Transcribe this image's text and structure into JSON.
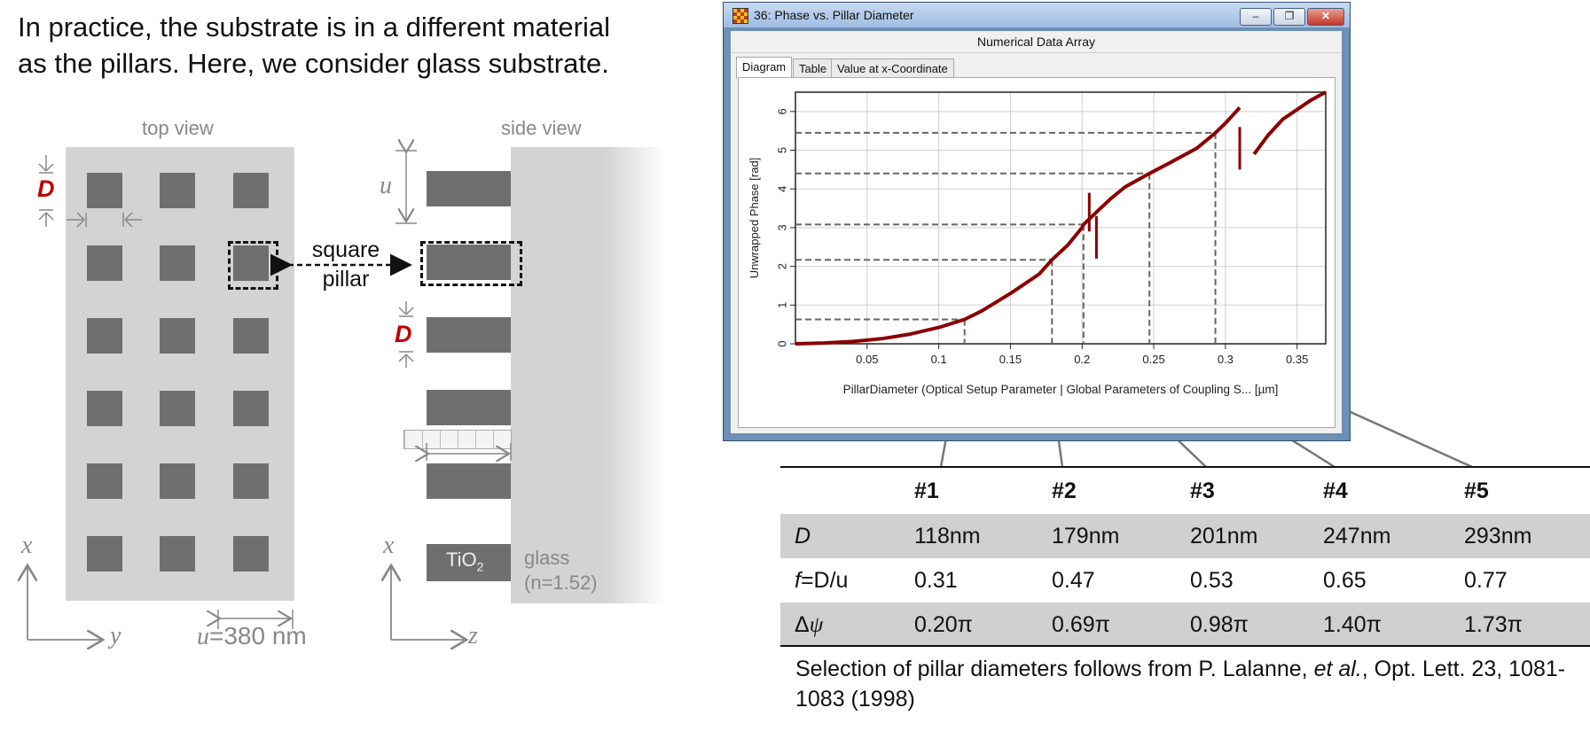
{
  "intro": {
    "line1": "In practice, the substrate is in a different material",
    "line2": "as the pillars. Here, we consider glass substrate."
  },
  "diagram": {
    "top_view_label": "top view",
    "side_view_label": "side view",
    "d_symbol": "D",
    "u_symbol": "u",
    "pillar_label_line1": "square",
    "pillar_label_line2": "pillar",
    "x_axis_symbol": "x",
    "y_axis_symbol": "y",
    "z_axis_symbol": "z",
    "period_label_var": "u",
    "period_label_value": "=380 nm",
    "tio2_label": "TiO",
    "tio2_sub": "2",
    "glass_label": "glass",
    "glass_index": "(n=1.52)"
  },
  "window": {
    "title": "36: Phase vs. Pillar Diameter",
    "header": "Numerical Data Array",
    "tabs": [
      "Diagram",
      "Table",
      "Value at x-Coordinate"
    ],
    "active_tab": "Diagram",
    "buttons": {
      "minimize": "‒",
      "restore": "❐",
      "close": "✕"
    }
  },
  "chart_data": {
    "type": "line",
    "xlabel": "PillarDiameter (Optical Setup Parameter | Global Parameters of Coupling S... [µm]",
    "ylabel": "Unwrapped Phase [rad]",
    "xlim": [
      0,
      0.37
    ],
    "ylim": [
      0,
      6.5
    ],
    "x_ticks": [
      "0.05",
      "0.1",
      "0.15",
      "0.2",
      "0.25",
      "0.3",
      "0.35"
    ],
    "x_tick_values": [
      0.05,
      0.1,
      0.15,
      0.2,
      0.25,
      0.3,
      0.35
    ],
    "y_ticks": [
      "0",
      "1",
      "2",
      "3",
      "4",
      "5",
      "6"
    ],
    "y_tick_values": [
      0,
      1,
      2,
      3,
      4,
      5,
      6
    ],
    "grid": true,
    "line_color": "#8b0000",
    "series": [
      {
        "x": [
          0,
          0.02,
          0.04,
          0.06,
          0.08,
          0.1,
          0.118,
          0.13,
          0.15,
          0.17,
          0.179,
          0.19,
          0.2,
          0.201,
          0.21,
          0.22,
          0.23,
          0.247,
          0.26,
          0.28,
          0.293,
          0.3,
          0.31,
          0.32,
          0.33,
          0.34,
          0.35,
          0.36,
          0.37
        ],
        "y": [
          0.0,
          0.02,
          0.06,
          0.13,
          0.25,
          0.42,
          0.63,
          0.85,
          1.3,
          1.8,
          2.17,
          2.55,
          3.0,
          3.08,
          3.4,
          3.75,
          4.05,
          4.4,
          4.65,
          5.05,
          5.45,
          5.7,
          6.1,
          4.9,
          5.4,
          5.8,
          6.05,
          6.3,
          6.5
        ]
      }
    ],
    "markers": [
      {
        "id": "#1",
        "x": 0.118,
        "y": 0.63
      },
      {
        "id": "#2",
        "x": 0.179,
        "y": 2.17
      },
      {
        "id": "#3",
        "x": 0.201,
        "y": 3.08
      },
      {
        "id": "#4",
        "x": 0.247,
        "y": 4.4
      },
      {
        "id": "#5",
        "x": 0.293,
        "y": 5.45
      }
    ]
  },
  "table": {
    "headers": [
      "",
      "#1",
      "#2",
      "#3",
      "#4",
      "#5"
    ],
    "rows": [
      {
        "label": "D",
        "values": [
          "118nm",
          "179nm",
          "201nm",
          "247nm",
          "293nm"
        ]
      },
      {
        "label_var": "f",
        "label_rest": "=D/u",
        "values": [
          "0.31",
          "0.47",
          "0.53",
          "0.65",
          "0.77"
        ]
      },
      {
        "label_delta": "Δ",
        "label_psi": "ψ",
        "values": [
          "0.20π",
          "0.69π",
          "0.98π",
          "1.40π",
          "1.73π"
        ]
      }
    ]
  },
  "reference": {
    "prefix": "Selection of pillar diameters follows from P. Lalanne, ",
    "etal": "et al.",
    "suffix": ", Opt. Lett. 23, 1081-1083 (1998)"
  }
}
